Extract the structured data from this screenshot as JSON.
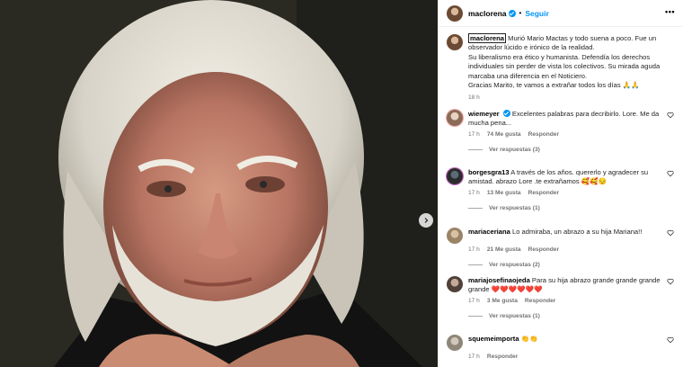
{
  "post": {
    "header": {
      "username": "maclorena",
      "follow_label": "Seguir",
      "dot": "•",
      "more": "•••"
    },
    "caption": {
      "username": "maclorena",
      "text": "Murió Mario Mactas y todo suena a poco. Fue un observador lúcido e irónico de la realidad.",
      "text2": "Su liberalismo era ético y humanista. Defendía los derechos individuales sin perder de vista los colectivos. Su mirada aguda marcaba una diferencia en el Noticiero.",
      "text3": "Gracias Marito, te vamos a extrañar todos los días 🙏🙏",
      "time": "18 h"
    },
    "comments": [
      {
        "username": "wiemeyer",
        "verified": true,
        "text": "Excelentes palabras para decribirlo. Lore. Me da mucha pena...",
        "time": "17 h",
        "likes": "74 Me gusta",
        "reply": "Responder",
        "replies": "Ver respuestas (3)"
      },
      {
        "username": "borgesgra13",
        "verified": false,
        "text": "A través de los años. quererlo y agradecer su amistad. abrazo Lore .te extrañamos 🥰🥰😔",
        "time": "17 h",
        "likes": "13 Me gusta",
        "reply": "Responder",
        "replies": "Ver respuestas (1)"
      },
      {
        "username": "mariaceriana",
        "verified": false,
        "text": "Lo admiraba, un abrazo a su hija Mariana!!",
        "time": "17 h",
        "likes": "21 Me gusta",
        "reply": "Responder",
        "replies": "Ver respuestas (2)"
      },
      {
        "username": "mariajosefinaojeda",
        "verified": false,
        "text": "Para su hija abrazo grande grande grande grande ❤️❤️❤️❤️❤️❤️",
        "time": "17 h",
        "likes": "3 Me gusta",
        "reply": "Responder",
        "replies": "Ver respuestas (1)"
      },
      {
        "username": "squemeimporta",
        "verified": false,
        "text": "👏👏",
        "time": "17 h",
        "likes": "",
        "reply": "Responder",
        "replies": ""
      }
    ]
  },
  "icons": {
    "next": "chevron-right-icon",
    "like": "heart-outline-icon",
    "verified": "verified-badge-icon"
  },
  "colors": {
    "accent": "#0095f6",
    "muted": "#737373"
  }
}
